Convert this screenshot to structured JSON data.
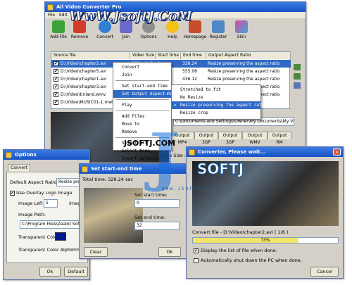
{
  "brand": {
    "watermark_top": "WwW.JsoftJ.CoM",
    "watermark_mid": "JSOFTJ.COM",
    "watermark_logo": "SOFTJ",
    "watermark_dots": "WWW.JSOFTJ.COM"
  },
  "main": {
    "title": "All Video Converter Pro",
    "menubar": [
      "File",
      "Edit"
    ],
    "toolbar": [
      "Add File",
      "Remove",
      "Convert",
      "Join",
      "Options",
      "Help",
      "Homepage",
      "Register",
      "Skin"
    ],
    "columns": [
      "Source file",
      "Video Size",
      "Start time",
      "End time",
      "Output Aspect Ratio"
    ],
    "rows": [
      {
        "file": "D:\\Video\\chapter2.avi",
        "size": "352 x 240",
        "start": "0",
        "end": "328.24",
        "aspect": "Resize preserving the aspect ratio",
        "selected": true
      },
      {
        "file": "D:\\Video\\chapter5.avi",
        "size": "",
        "start": "",
        "end": "555.06",
        "aspect": "Resize preserving the aspect ratio",
        "selected": false
      },
      {
        "file": "D:\\Video\\chapter1.avi",
        "size": "",
        "start": "",
        "end": "436.12",
        "aspect": "Resize preserving the aspect ratio",
        "selected": false
      },
      {
        "file": "D:\\Video\\chapter3.avi",
        "size": "",
        "start": "",
        "end": "483.02",
        "aspect": "Resize preserving the aspect ratio",
        "selected": false
      },
      {
        "file": "D:\\Video\\tinland.wmv",
        "size": "",
        "start": "",
        "end": "126.25",
        "aspect": "Resize preserving the aspect ratio",
        "selected": false
      },
      {
        "file": "D:\\Video\\MUSIC01-1.mwb",
        "size": "",
        "start": "",
        "end": "",
        "aspect": "",
        "selected": false
      }
    ],
    "output_path": "C:\\Documents and Settings\\Owner\\My Documents\\My Videos\\",
    "output_tabs": [
      "Output MP4",
      "Output 3GP",
      "Output 3GP",
      "Output WMV",
      "Output RM"
    ],
    "video_size_label": "Video Size :"
  },
  "context_menu": {
    "items": [
      "Convert",
      "Join",
      "Set start-end time",
      "Set Output Aspect Ratio",
      "Play",
      "Add Files",
      "Move to",
      "Remove",
      "Select All",
      "Select None",
      "Invert Selection"
    ],
    "submenu_arrow": "▸"
  },
  "submenu": {
    "items": [
      "Stretched to fit",
      "No Resize",
      "Resize preserving the aspect ratio",
      "Resize crop"
    ],
    "checked_index": 2
  },
  "options": {
    "title": "Options",
    "tab": "Convert",
    "default_aspect_label": "Default Aspect Ratio :",
    "default_aspect_value": "Resize preserv",
    "overlay_label": "Use Overlay Logo Image",
    "image_left_label": "Image Left :",
    "image_left_value": "5",
    "image_label2": "Image",
    "image_path_label": "Image Path:",
    "image_path_value": "C:\\Program Files\\Zealot Software",
    "transparent_color_label": "Transparent Color :",
    "transparent_alpha_label": "Transparent Color Alpha :",
    "transparent_color": "#001a8c",
    "ok": "Ok",
    "default": "Default",
    "cancel": "Cancel"
  },
  "setstart": {
    "title": "Set start-end time",
    "total_time": "Total time:    328.24  sec",
    "start_label": "Set start time:",
    "start_value": "0",
    "end_label": "Set end time:",
    "end_value": "32",
    "clear": "Clear",
    "ok": "Ok"
  },
  "converter": {
    "title": "Converter, Please wait...",
    "status": "Convert file - D:\\Video\\chapter2.avi ( 1/6 )",
    "progress_percent": 73,
    "progress_text": "73%",
    "display_list_label": "Display the list of file when done.",
    "display_list_checked": true,
    "shutdown_label": "Automatically shut down the PC when done.",
    "shutdown_checked": false,
    "cancel": "Cancel"
  },
  "colors": {
    "title_blue": "#1653c6",
    "selection": "#316ac5",
    "progress": "#f3e36a"
  }
}
